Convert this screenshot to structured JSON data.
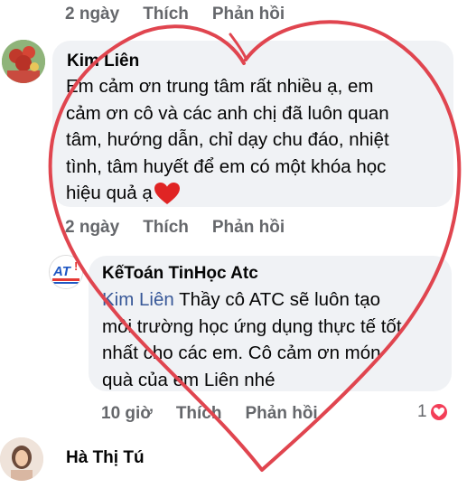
{
  "comments": [
    {
      "top_actions": {
        "time": "2 ngày",
        "like": "Thích",
        "reply": "Phản hồi"
      },
      "author": "Kim Liên",
      "text_lines": [
        "Em cảm ơn trung tâm rất nhiều ạ, em",
        "cảm ơn cô và các anh chị đã luôn quan",
        "tâm, hướng dẫn, chỉ dạy chu đáo, nhiệt",
        "tình, tâm huyết để em có một khóa học",
        "hiệu quả ạ"
      ],
      "actions": {
        "time": "2 ngày",
        "like": "Thích",
        "reply": "Phản hồi"
      }
    }
  ],
  "reply": {
    "author": "KếToán TinHọc Atc",
    "avatar_text": "AT",
    "mention": "Kim Liên",
    "text_lines": [
      " Thầy cô ATC sẽ luôn tạo",
      "môi trường học ứng dụng thực tế tốt",
      "nhất cho các em. Cô cảm ơn món",
      "quà của em Liên nhé"
    ],
    "actions": {
      "time": "10 giờ",
      "like": "Thích",
      "reply": "Phản hồi"
    },
    "reaction_count": "1"
  },
  "next_comment": {
    "author": "Hà Thị Tú"
  },
  "colors": {
    "bubble": "#f0f2f5",
    "mention": "#385898",
    "heart_drawing": "#e0454f",
    "reaction": "#f33e58"
  }
}
